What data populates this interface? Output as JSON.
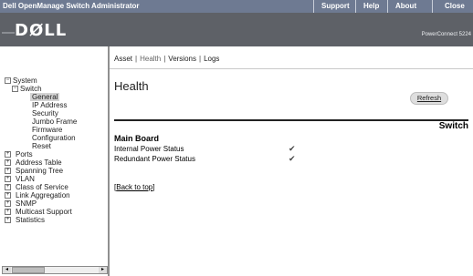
{
  "titlebar": {
    "app_title": "Dell OpenManage Switch Administrator",
    "links": [
      "Support",
      "Help",
      "About",
      "Close"
    ]
  },
  "brand": {
    "logo": "DØLL",
    "product": "PowerConnect 5224"
  },
  "nav": {
    "items": [
      {
        "label": "System",
        "expander": "−"
      },
      {
        "label": "Switch",
        "expander": "−"
      },
      {
        "label": "General",
        "selected": true
      },
      {
        "label": "IP Address"
      },
      {
        "label": "Security"
      },
      {
        "label": "Jumbo Frame"
      },
      {
        "label": "Firmware"
      },
      {
        "label": "Configuration"
      },
      {
        "label": "Reset"
      },
      {
        "label": "Ports",
        "expander": "+"
      },
      {
        "label": "Address Table",
        "expander": "+"
      },
      {
        "label": "Spanning Tree",
        "expander": "+"
      },
      {
        "label": "VLAN",
        "expander": "+"
      },
      {
        "label": "Class of Service",
        "expander": "+"
      },
      {
        "label": "Link Aggregation",
        "expander": "+"
      },
      {
        "label": "SNMP",
        "expander": "+"
      },
      {
        "label": "Multicast Support",
        "expander": "+"
      },
      {
        "label": "Statistics",
        "expander": "+"
      }
    ],
    "scroll_left": "◂",
    "scroll_right": "▸"
  },
  "tabs": {
    "items": [
      "Asset",
      "Health",
      "Versions",
      "Logs"
    ],
    "separator": "|",
    "current": "Health"
  },
  "page": {
    "title": "Health",
    "refresh_label": "Refresh",
    "section_title": "Switch",
    "subsection_title": "Main Board",
    "rows": [
      {
        "label": "Internal Power Status",
        "status": "✔"
      },
      {
        "label": "Redundant Power Status",
        "status": "✔"
      }
    ],
    "back_to_top_open": "[",
    "back_to_top_label": "Back to top",
    "back_to_top_close": "]"
  }
}
